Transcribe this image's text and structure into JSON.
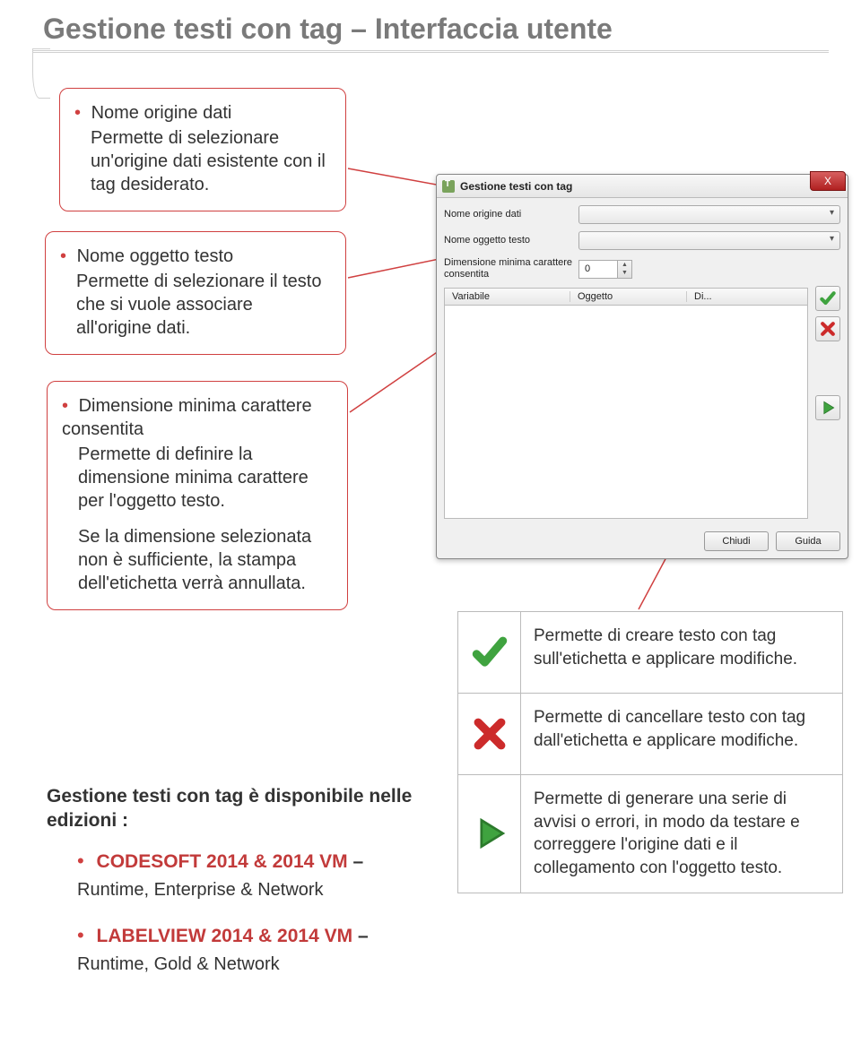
{
  "page": {
    "title": "Gestione testi con tag – Interfaccia utente"
  },
  "callouts": {
    "origin": {
      "title": "Nome origine dati",
      "body": "Permette di selezionare un'origine dati esistente con il tag desiderato."
    },
    "object": {
      "title": "Nome oggetto testo",
      "body": "Permette di selezionare il testo che si vuole associare all'origine dati."
    },
    "minsize": {
      "title": "Dimensione minima carattere consentita",
      "body": "Permette di definire la dimensione minima carattere per l'oggetto testo.",
      "body2": "Se la dimensione selezionata non è sufficiente, la stampa dell'etichetta verrà annullata."
    }
  },
  "dialog": {
    "title": "Gestione testi con tag",
    "labels": {
      "origin": "Nome origine dati",
      "object": "Nome oggetto testo",
      "minsize": "Dimensione minima carattere consentita"
    },
    "spinValue": "0",
    "columns": {
      "c1": "Variabile",
      "c2": "Oggetto",
      "c3": "Di..."
    },
    "buttons": {
      "close": "Chiudi",
      "help": "Guida"
    },
    "closeX": "X"
  },
  "legend": {
    "apply": "Permette di creare testo con tag sull'etichetta e applicare modifiche.",
    "delete": "Permette di cancellare testo con tag dall'etichetta e applicare modifiche.",
    "run": "Permette di generare una serie di avvisi o errori, in modo da testare e correggere l'origine dati e il collegamento con l'oggetto testo."
  },
  "editions": {
    "heading": "Gestione testi con tag è disponibile nelle edizioni :",
    "items": [
      {
        "name": "CODESOFT 2014 & 2014 VM",
        "sub": "Runtime, Enterprise & Network"
      },
      {
        "name": "LABELVIEW 2014 & 2014 VM",
        "sub": "Runtime, Gold & Network"
      }
    ]
  }
}
